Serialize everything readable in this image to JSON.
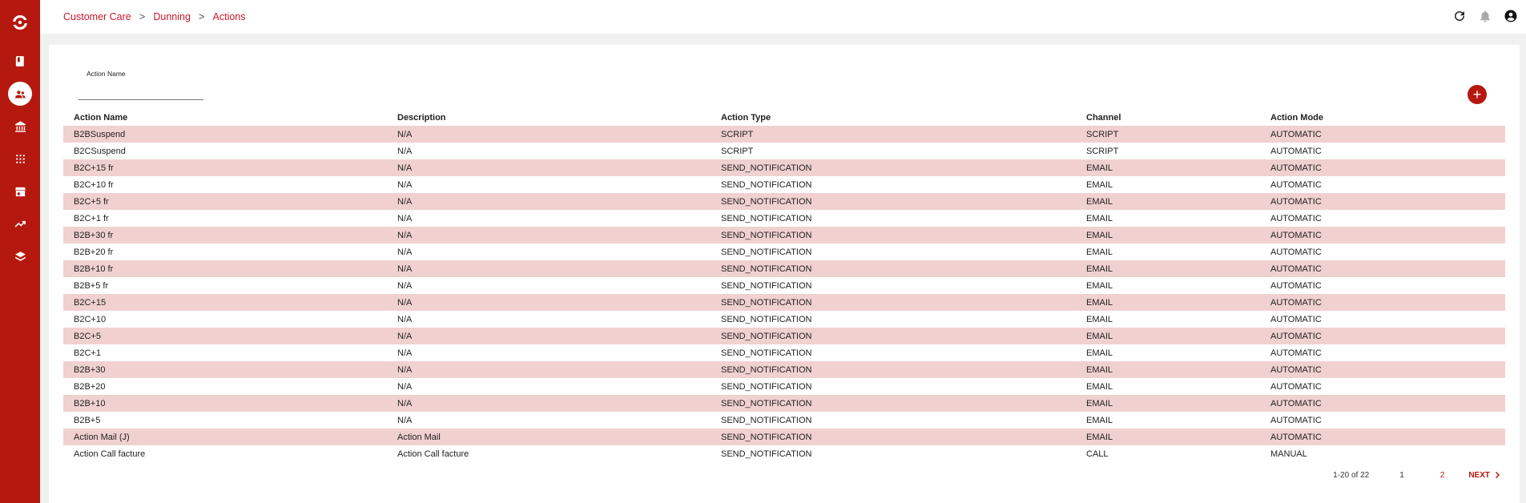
{
  "sidebar": {
    "logo": "brand-logo",
    "items": [
      {
        "name": "book-icon"
      },
      {
        "name": "customers-icon",
        "active": true
      },
      {
        "name": "bank-icon"
      },
      {
        "name": "grid-dots-icon"
      },
      {
        "name": "store-icon"
      },
      {
        "name": "trending-icon"
      },
      {
        "name": "layers-icon"
      }
    ],
    "accent": "#b5180f"
  },
  "breadcrumb": {
    "items": [
      "Customer Care",
      "Dunning",
      "Actions"
    ],
    "separator": ">"
  },
  "topbar": {
    "icons": [
      "refresh-icon",
      "bell-icon",
      "account-icon"
    ]
  },
  "filter": {
    "label": "Action Name",
    "value": ""
  },
  "add_button": {
    "label": "+"
  },
  "table": {
    "headers": [
      "Action Name",
      "Description",
      "Action Type",
      "Channel",
      "Action Mode"
    ],
    "rows": [
      [
        "B2BSuspend",
        "N/A",
        "SCRIPT",
        "SCRIPT",
        "AUTOMATIC"
      ],
      [
        "B2CSuspend",
        "N/A",
        "SCRIPT",
        "SCRIPT",
        "AUTOMATIC"
      ],
      [
        "B2C+15 fr",
        "N/A",
        "SEND_NOTIFICATION",
        "EMAIL",
        "AUTOMATIC"
      ],
      [
        "B2C+10 fr",
        "N/A",
        "SEND_NOTIFICATION",
        "EMAIL",
        "AUTOMATIC"
      ],
      [
        "B2C+5 fr",
        "N/A",
        "SEND_NOTIFICATION",
        "EMAIL",
        "AUTOMATIC"
      ],
      [
        "B2C+1 fr",
        "N/A",
        "SEND_NOTIFICATION",
        "EMAIL",
        "AUTOMATIC"
      ],
      [
        "B2B+30 fr",
        "N/A",
        "SEND_NOTIFICATION",
        "EMAIL",
        "AUTOMATIC"
      ],
      [
        "B2B+20 fr",
        "N/A",
        "SEND_NOTIFICATION",
        "EMAIL",
        "AUTOMATIC"
      ],
      [
        "B2B+10 fr",
        "N/A",
        "SEND_NOTIFICATION",
        "EMAIL",
        "AUTOMATIC"
      ],
      [
        "B2B+5 fr",
        "N/A",
        "SEND_NOTIFICATION",
        "EMAIL",
        "AUTOMATIC"
      ],
      [
        "B2C+15",
        "N/A",
        "SEND_NOTIFICATION",
        "EMAIL",
        "AUTOMATIC"
      ],
      [
        "B2C+10",
        "N/A",
        "SEND_NOTIFICATION",
        "EMAIL",
        "AUTOMATIC"
      ],
      [
        "B2C+5",
        "N/A",
        "SEND_NOTIFICATION",
        "EMAIL",
        "AUTOMATIC"
      ],
      [
        "B2C+1",
        "N/A",
        "SEND_NOTIFICATION",
        "EMAIL",
        "AUTOMATIC"
      ],
      [
        "B2B+30",
        "N/A",
        "SEND_NOTIFICATION",
        "EMAIL",
        "AUTOMATIC"
      ],
      [
        "B2B+20",
        "N/A",
        "SEND_NOTIFICATION",
        "EMAIL",
        "AUTOMATIC"
      ],
      [
        "B2B+10",
        "N/A",
        "SEND_NOTIFICATION",
        "EMAIL",
        "AUTOMATIC"
      ],
      [
        "B2B+5",
        "N/A",
        "SEND_NOTIFICATION",
        "EMAIL",
        "AUTOMATIC"
      ],
      [
        "Action Mail (J)",
        "Action Mail",
        "SEND_NOTIFICATION",
        "EMAIL",
        "AUTOMATIC"
      ],
      [
        "Action Call facture",
        "Action Call facture",
        "SEND_NOTIFICATION",
        "CALL",
        "MANUAL"
      ]
    ]
  },
  "pagination": {
    "range": "1-20 of 22",
    "pages": [
      "1",
      "2"
    ],
    "current": "1",
    "next_label": "NEXT"
  }
}
